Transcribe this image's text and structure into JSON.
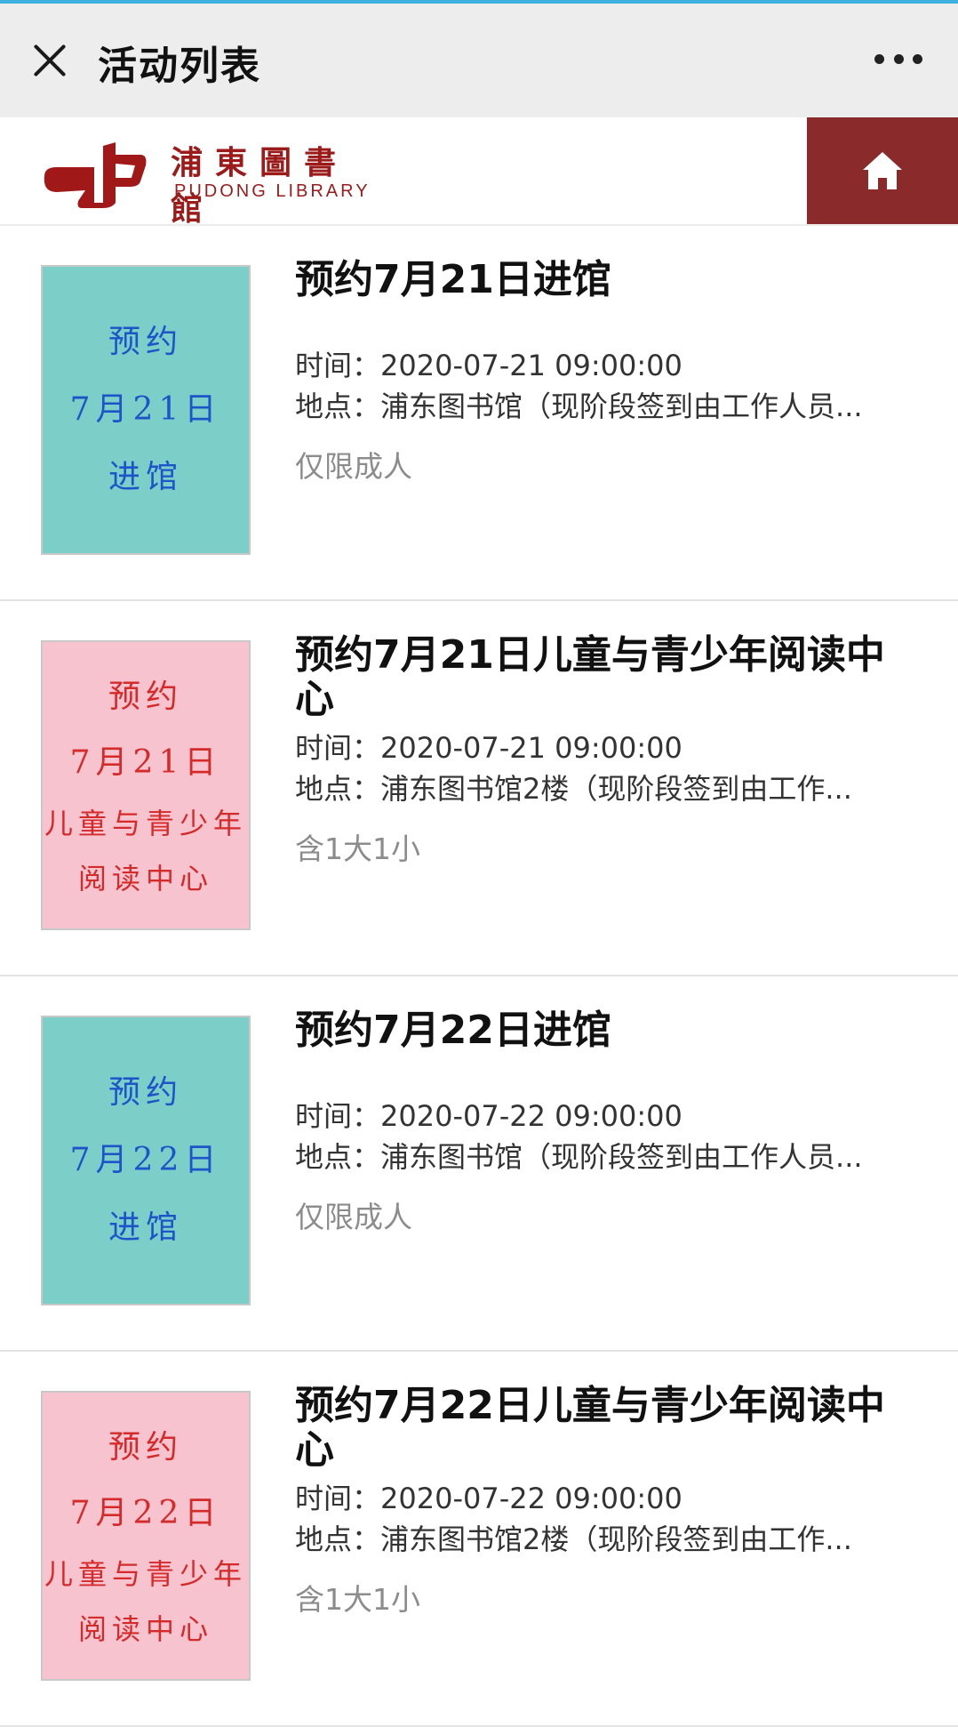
{
  "navbar": {
    "title": "活动列表",
    "close_icon": "close-icon",
    "more_icon": "more-icon"
  },
  "header": {
    "logo_cn": "浦東圖書館",
    "logo_en": "PUDONG LIBRARY",
    "home_icon": "home-icon",
    "brand_color": "#8b2a2a"
  },
  "activities": [
    {
      "title": "预约7月21日进馆",
      "time_label": "时间：",
      "time": "2020-07-21 09:00:00",
      "place_label": "地点：",
      "place": "浦东图书馆（现阶段签到由工作人员...",
      "tag": "仅限成人",
      "thumb": {
        "color": "teal",
        "lines": [
          "预约",
          "7月21日",
          "进馆"
        ]
      }
    },
    {
      "title": "预约7月21日儿童与青少年阅读中心",
      "time_label": "时间：",
      "time": "2020-07-21 09:00:00",
      "place_label": "地点：",
      "place": "浦东图书馆2楼（现阶段签到由工作...",
      "tag": "含1大1小",
      "thumb": {
        "color": "pink",
        "lines": [
          "预约",
          "7月21日",
          "儿童与青少年",
          "阅读中心"
        ]
      }
    },
    {
      "title": "预约7月22日进馆",
      "time_label": "时间：",
      "time": "2020-07-22 09:00:00",
      "place_label": "地点：",
      "place": "浦东图书馆（现阶段签到由工作人员...",
      "tag": "仅限成人",
      "thumb": {
        "color": "teal",
        "lines": [
          "预约",
          "7月22日",
          "进馆"
        ]
      }
    },
    {
      "title": "预约7月22日儿童与青少年阅读中心",
      "time_label": "时间：",
      "time": "2020-07-22 09:00:00",
      "place_label": "地点：",
      "place": "浦东图书馆2楼（现阶段签到由工作...",
      "tag": "含1大1小",
      "thumb": {
        "color": "pink",
        "lines": [
          "预约",
          "7月22日",
          "儿童与青少年",
          "阅读中心"
        ]
      }
    }
  ],
  "colors": {
    "teal_thumb": "#7ccfc9",
    "teal_text": "#1d55c9",
    "pink_thumb": "#f7c3cf",
    "pink_text": "#d42a2a"
  }
}
